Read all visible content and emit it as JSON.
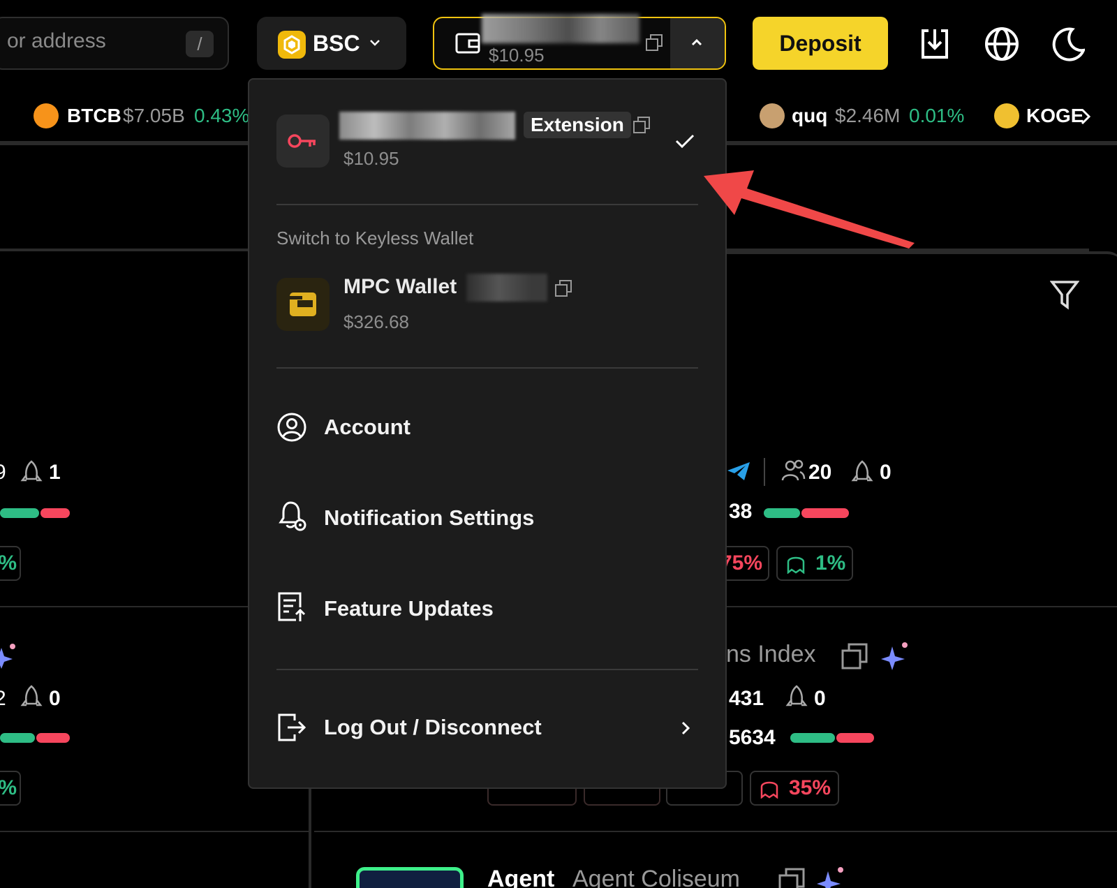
{
  "header": {
    "search_text": "or address",
    "search_shortcut": "/",
    "chain_label": "BSC",
    "wallet_balance": "$10.95",
    "deposit_label": "Deposit",
    "icons": [
      "download-icon",
      "globe-icon",
      "moon-icon"
    ]
  },
  "ticker": [
    {
      "name": "BTCB",
      "value": "$7.05B",
      "change": "0.43%"
    },
    {
      "name": "quq",
      "value": "$2.46M",
      "change": "0.01%"
    },
    {
      "name": "KOGE",
      "value": "",
      "change": ""
    }
  ],
  "background": {
    "left_stats": [
      "1",
      "0"
    ],
    "left_pct_fragment": "%",
    "right_count_users": "20",
    "right_count_rockets": "0",
    "right_num_1": "38",
    "right_pct_red": "75%",
    "right_pct_green": "1%",
    "index_title_fragment": "ns Index",
    "right_num_2": "431",
    "right_num_2_rockets": "0",
    "right_num_3": "5634",
    "right_pct_bottom": "35%",
    "left_frag_9": "9",
    "left_frag_2": "2",
    "bottom_name": "Agent",
    "bottom_sub": "Agent Coliseum"
  },
  "menu": {
    "current_wallet": {
      "badge": "Extension",
      "balance": "$10.95",
      "selected": true
    },
    "switch_label": "Switch to Keyless Wallet",
    "mpc_wallet": {
      "title": "MPC Wallet",
      "balance": "$326.68"
    },
    "items": [
      {
        "label": "Account",
        "icon": "user-circle-icon"
      },
      {
        "label": "Notification Settings",
        "icon": "bell-settings-icon"
      },
      {
        "label": "Feature Updates",
        "icon": "document-update-icon"
      }
    ],
    "logout_label": "Log Out / Disconnect"
  },
  "colors": {
    "accent_yellow": "#f5d42a",
    "positive_green": "#2ebd85",
    "negative_red": "#f6465d",
    "annotation_arrow": "#f04848"
  }
}
